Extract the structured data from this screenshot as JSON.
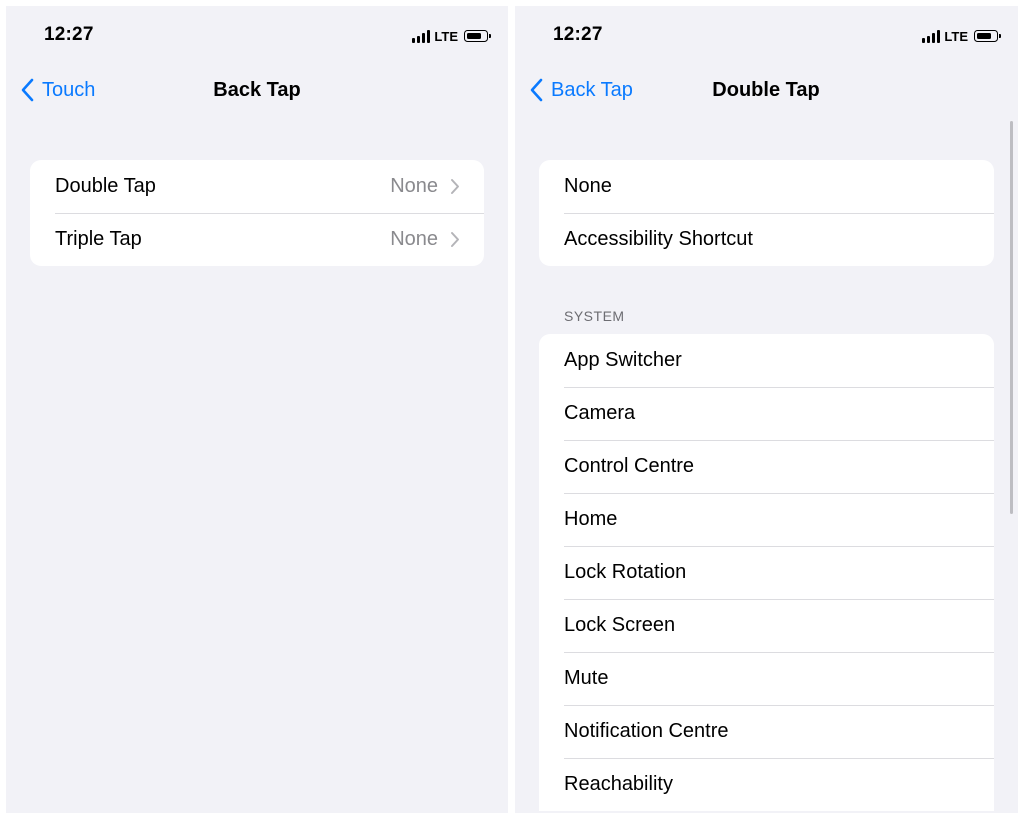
{
  "left_screen": {
    "status": {
      "time": "12:27",
      "network": "LTE"
    },
    "nav": {
      "back_label": "Touch",
      "title": "Back Tap"
    },
    "rows": [
      {
        "label": "Double Tap",
        "value": "None"
      },
      {
        "label": "Triple Tap",
        "value": "None"
      }
    ]
  },
  "right_screen": {
    "status": {
      "time": "12:27",
      "network": "LTE"
    },
    "nav": {
      "back_label": "Back Tap",
      "title": "Double Tap"
    },
    "top_options": [
      "None",
      "Accessibility Shortcut"
    ],
    "system_header": "SYSTEM",
    "system_options": [
      "App Switcher",
      "Camera",
      "Control Centre",
      "Home",
      "Lock Rotation",
      "Lock Screen",
      "Mute",
      "Notification Centre",
      "Reachability"
    ]
  },
  "icons": {
    "back": "chevron-left-icon",
    "disclosure": "chevron-right-icon",
    "signal": "cellular-signal-icon",
    "battery": "battery-icon"
  },
  "colors": {
    "accent": "#0a7aff",
    "background": "#f2f2f7",
    "secondary_text": "#8a8a8e"
  }
}
